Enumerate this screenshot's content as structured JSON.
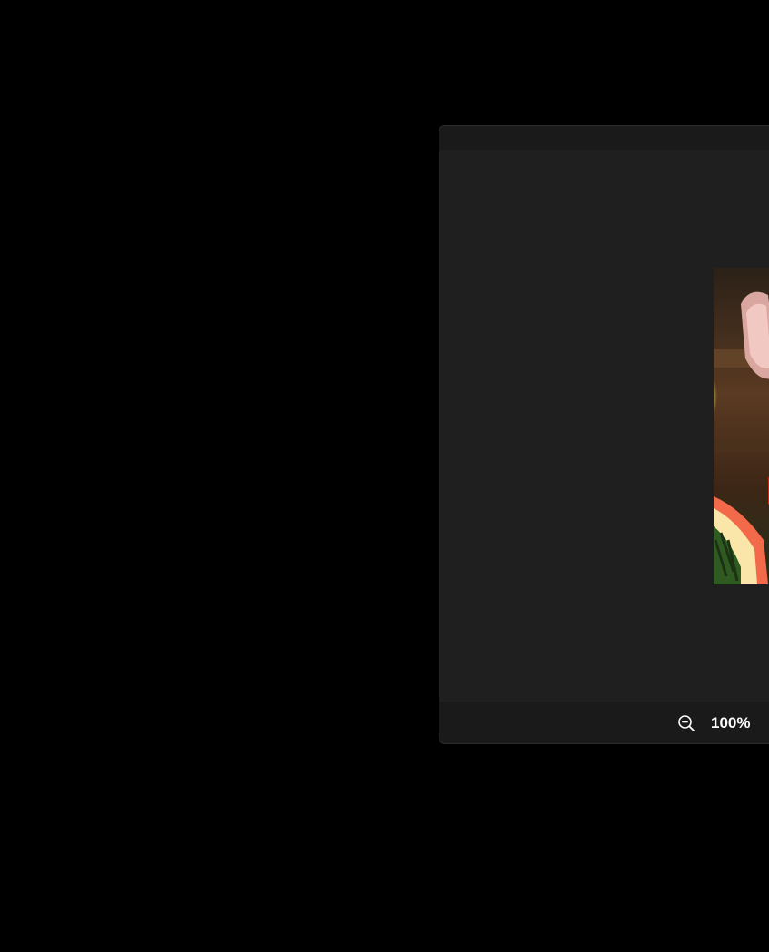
{
  "viewer": {
    "zoom_level": "100%",
    "zoom_out_icon": "zoom-out-icon"
  },
  "colors": {
    "desktop_background": "#000000",
    "window_background": "#1f1f1f",
    "toolbar_background": "#1a1a1a",
    "text": "#ffffff"
  }
}
